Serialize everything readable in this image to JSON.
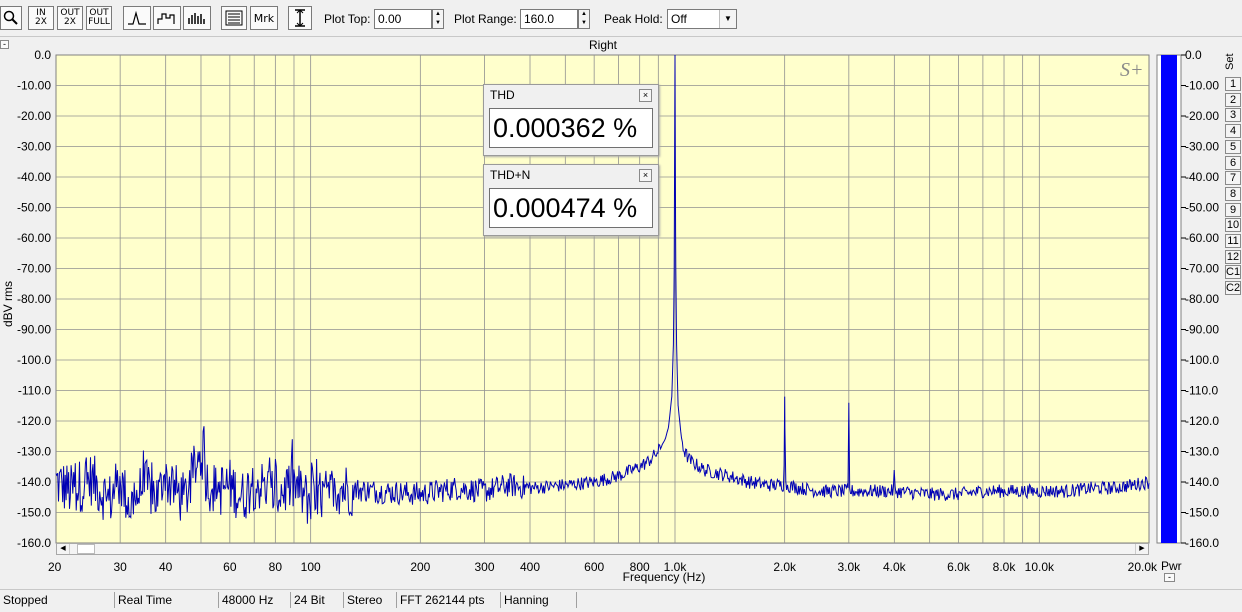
{
  "toolbar": {
    "zoom_in_label": "IN 2X",
    "zoom_out_label": "OUT 2X",
    "zoom_full_label": "OUT FULL",
    "marker_label": "Mrk",
    "plot_top_label": "Plot Top:",
    "plot_top_value": "0.00",
    "plot_range_label": "Plot Range:",
    "plot_range_value": "160.0",
    "peak_hold_label": "Peak Hold:",
    "peak_hold_value": "Off"
  },
  "thd_panel": {
    "title": "THD",
    "value": "0.000362 %",
    "close": "×"
  },
  "thdn_panel": {
    "title": "THD+N",
    "value": "0.000474 %",
    "close": "×"
  },
  "side_buttons": [
    "1",
    "2",
    "3",
    "4",
    "5",
    "6",
    "7",
    "8",
    "9",
    "10",
    "11",
    "12",
    "C1",
    "C2"
  ],
  "side_labels": {
    "set": "Set",
    "pwr": "Pwr"
  },
  "status": {
    "state": "Stopped",
    "mode": "Real Time",
    "sample_rate": "48000 Hz",
    "bit_depth": "24 Bit",
    "channels": "Stereo",
    "fft_size": "FFT 262144 pts",
    "window": "Hanning"
  },
  "colors": {
    "plot_bg": "#ffffcc",
    "trace": "#0000b4",
    "grid": "#909090",
    "level_bar": "#0000ff"
  },
  "chart_data": {
    "type": "line",
    "title": "Right",
    "xlabel": "Frequency (Hz)",
    "ylabel": "dBV rms",
    "x_scale": "log",
    "xlim": [
      20,
      20000
    ],
    "ylim": [
      -160,
      0
    ],
    "x_ticks": [
      20,
      30,
      40,
      60,
      80,
      100,
      200,
      300,
      400,
      600,
      800,
      1000,
      2000,
      3000,
      4000,
      6000,
      8000,
      10000,
      20000
    ],
    "x_tick_labels": [
      "20",
      "30",
      "40",
      "60",
      "80",
      "100",
      "200",
      "300",
      "400",
      "600",
      "800",
      "1.0k",
      "2.0k",
      "3.0k",
      "4.0k",
      "6.0k",
      "8.0k",
      "10.0k",
      "20.0k"
    ],
    "y_ticks": [
      0,
      -10,
      -20,
      -30,
      -40,
      -50,
      -60,
      -70,
      -80,
      -90,
      -100,
      -110,
      -120,
      -130,
      -140,
      -150,
      -160
    ],
    "y_tick_labels": [
      "0.0",
      "-10.00",
      "-20.00",
      "-30.00",
      "-40.00",
      "-50.00",
      "-60.00",
      "-70.00",
      "-80.00",
      "-90.00",
      "-100.0",
      "-110.0",
      "-120.0",
      "-130.0",
      "-140.0",
      "-150.0",
      "-160.0"
    ],
    "right_tick_labels": [
      "0.0",
      "-10.00",
      "-20.00",
      "-30.00",
      "-40.00",
      "-50.00",
      "-60.00",
      "-70.00",
      "-80.00",
      "-90.00",
      "-100.0",
      "-110.0",
      "-120.0",
      "-130.0",
      "-140.0",
      "-150.0",
      "-160.0"
    ],
    "grid": true,
    "level_bar_db": 0,
    "series": [
      {
        "x": [
          20,
          22,
          25,
          28,
          30,
          32,
          35,
          38,
          40,
          45,
          50,
          52,
          55,
          60,
          65,
          70,
          80,
          90,
          100,
          120,
          150,
          200,
          250,
          300,
          350,
          400,
          500,
          600,
          700,
          800,
          850,
          900,
          940,
          960,
          980,
          990,
          995,
          1000,
          1005,
          1010,
          1020,
          1040,
          1060,
          1100,
          1200,
          1400,
          1600,
          1800,
          1990,
          2000,
          2010,
          2200,
          2500,
          2990,
          3000,
          3010,
          3500,
          3990,
          4000,
          4010,
          5000,
          6000,
          7000,
          8000,
          10000,
          12000,
          14000,
          16000,
          18000,
          20000
        ],
        "y": [
          -140,
          -143,
          -139,
          -146,
          -140,
          -148,
          -141,
          -145,
          -139,
          -146,
          -130,
          -140,
          -143,
          -141,
          -145,
          -140,
          -144,
          -141,
          -147,
          -142,
          -143,
          -144,
          -142,
          -143,
          -141,
          -142,
          -141,
          -140,
          -138,
          -135,
          -133,
          -130,
          -126,
          -122,
          -112,
          -95,
          -70,
          0,
          -70,
          -95,
          -115,
          -125,
          -130,
          -133,
          -136,
          -138,
          -140,
          -141,
          -141,
          -112,
          -141,
          -142,
          -143,
          -143,
          -114,
          -143,
          -143,
          -143,
          -135,
          -143,
          -144,
          -144,
          -143,
          -143,
          -143,
          -143,
          -142,
          -142,
          -141,
          -140
        ]
      }
    ]
  }
}
